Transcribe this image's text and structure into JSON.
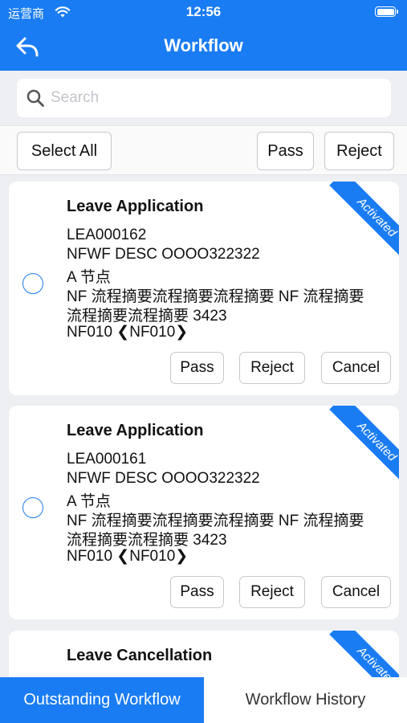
{
  "status_bar": {
    "carrier": "运营商",
    "time": "12:56"
  },
  "nav": {
    "title": "Workflow"
  },
  "search": {
    "placeholder": "Search"
  },
  "actions": {
    "select_all": "Select All",
    "pass": "Pass",
    "reject": "Reject"
  },
  "cards": [
    {
      "title": "Leave Application",
      "badge": "Activated",
      "lines": [
        "LEA000162",
        "NFWF DESC OOOO322322",
        "A 节点",
        "NF 流程摘要流程摘要流程摘要 NF 流程摘要",
        "流程摘要流程摘要 3423",
        "NF010 ❮NF010❯"
      ],
      "buttons": {
        "pass": "Pass",
        "reject": "Reject",
        "cancel": "Cancel"
      }
    },
    {
      "title": "Leave Application",
      "badge": "Activated",
      "lines": [
        "LEA000161",
        "NFWF DESC OOOO322322",
        "A 节点",
        "NF 流程摘要流程摘要流程摘要 NF 流程摘要",
        "流程摘要流程摘要 3423",
        "NF010 ❮NF010❯"
      ],
      "buttons": {
        "pass": "Pass",
        "reject": "Reject",
        "cancel": "Cancel"
      }
    },
    {
      "title": "Leave Cancellation",
      "badge": "Activated"
    }
  ],
  "tabs": {
    "outstanding": "Outstanding Workflow",
    "history": "Workflow History"
  },
  "icons": {
    "back": "back-arrow-icon",
    "search": "search-icon",
    "wifi": "wifi-icon",
    "battery": "battery-icon",
    "radio": "radio-unchecked-icon"
  },
  "colors": {
    "primary": "#1a7cf3",
    "background": "#eeeff3"
  }
}
